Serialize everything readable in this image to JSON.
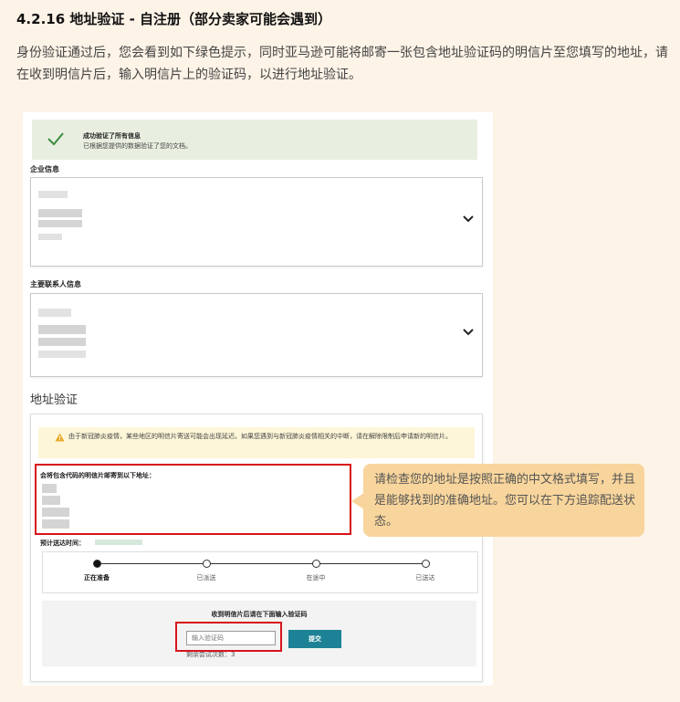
{
  "guide": {
    "title": "4.2.16 地址验证 - 自注册（部分卖家可能会遇到）",
    "intro": "身份验证通过后，您会看到如下绿色提示，同时亚马逊可能将邮寄一张包含地址验证码的明信片至您填写的地址，请在收到明信片后，输入明信片上的验证码，以进行地址验证。"
  },
  "screenshot": {
    "success": {
      "title": "成功验证了所有信息",
      "subtitle": "已根据您提供的数据验证了您的文档。",
      "color": "#e8efe0"
    },
    "business_info": {
      "label": "企业信息"
    },
    "primary_contact": {
      "label": "主要联系人信息"
    },
    "address_verification": {
      "heading": "地址验证",
      "notice": "由于新冠肺炎疫情，某些地区的明信片寄送可能会出现延迟。如果您遇到与新冠肺炎疫情相关的中断，请在解除限制后申请新的明信片。",
      "send_to_label": "会将包含代码的明信片邮寄到以下地址：",
      "eta_label": "预计送达时间：",
      "steps": [
        {
          "label": "正在准备",
          "active": true
        },
        {
          "label": "已派送",
          "active": false
        },
        {
          "label": "在途中",
          "active": false
        },
        {
          "label": "已送达",
          "active": false
        }
      ],
      "verify_title": "收到明信片后请在下面输入验证码",
      "code_placeholder": "输入验证码",
      "submit_label": "提交",
      "attempts_text": "剩余尝试次数：3"
    }
  },
  "callout": {
    "text": "请检查您的地址是按照正确的中文格式填写，并且是能够找到的准确地址。您可以在下方追踪配送状态。"
  },
  "colors": {
    "page_background": "#fdf3e7",
    "highlight_border": "#d8141b",
    "submit_button": "#1d8295",
    "callout_background": "#f8d59c"
  },
  "icons": [
    "check-icon",
    "chevron-down-icon",
    "warning-icon"
  ]
}
